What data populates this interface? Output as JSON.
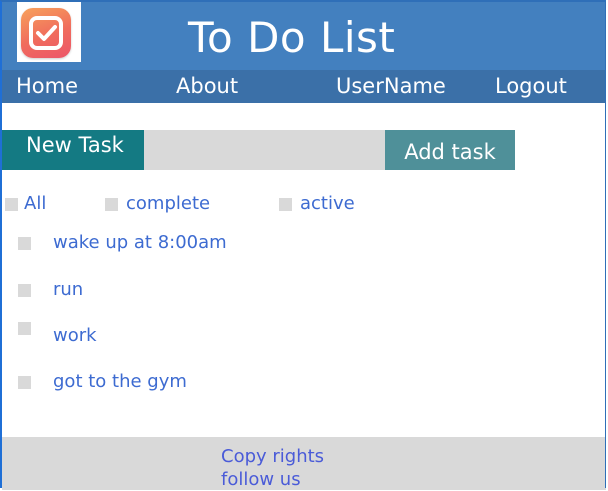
{
  "header": {
    "title": "To Do List",
    "logo": {
      "icon": "checkmark-app-icon"
    }
  },
  "nav": {
    "items": [
      {
        "label": "Home"
      },
      {
        "label": "About"
      },
      {
        "label": "UserName"
      },
      {
        "label": "Logout"
      }
    ]
  },
  "new_task": {
    "label": "New Task",
    "input_value": "",
    "placeholder": "",
    "add_button": "Add task"
  },
  "filters": [
    {
      "label": "All"
    },
    {
      "label": "complete"
    },
    {
      "label": "active"
    }
  ],
  "tasks": [
    {
      "label": "wake up at 8:00am",
      "done": false
    },
    {
      "label": "run",
      "done": false
    },
    {
      "label": "work",
      "done": false
    },
    {
      "label": "got to the gym",
      "done": false
    }
  ],
  "footer": {
    "copyright": "Copy rights",
    "follow": "follow us"
  },
  "colors": {
    "header_bg": "#4380bf",
    "nav_bg": "#3b70a8",
    "accent_teal": "#147a83",
    "button_teal": "#4f9099",
    "link_blue": "#3d6bd1",
    "footer_bg": "#d9d9d9"
  }
}
